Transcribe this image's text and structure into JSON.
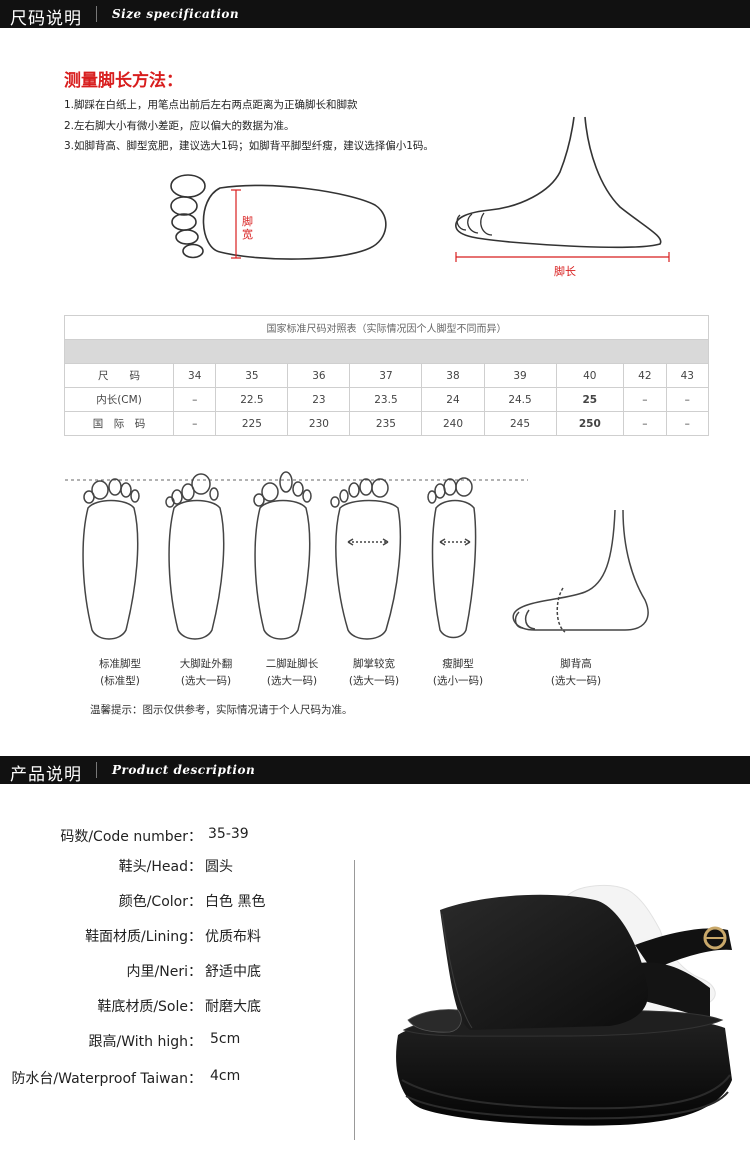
{
  "section1": {
    "title_cn": "尺码说明",
    "title_en": "Size specification"
  },
  "measure": {
    "title": "测量脚长方法：",
    "steps": [
      "1.脚踩在白纸上，用笔点出前后左右两点距离为正确脚长和脚款",
      "2.左右脚大小有微小差距，应以偏大的数据为准。",
      "3.如脚背高、脚型宽肥，建议选大1码；如脚背平脚型纤瘦，建议选择偏小1码。"
    ],
    "width_label": "脚宽",
    "length_label": "脚长"
  },
  "size_table": {
    "caption": "国家标准尺码对照表（实际情况因个人脚型不同而异）",
    "rows": [
      {
        "label": "尺　　码",
        "cells": [
          "34",
          "35",
          "36",
          "37",
          "38",
          "39",
          "40",
          "42",
          "43"
        ]
      },
      {
        "label": "内长(CM)",
        "cells": [
          "–",
          "22.5",
          "23",
          "23.5",
          "24",
          "24.5",
          "25",
          "–",
          "–"
        ]
      },
      {
        "label": "国　际　码",
        "cells": [
          "–",
          "225",
          "230",
          "235",
          "240",
          "245",
          "250",
          "–",
          "–"
        ]
      }
    ]
  },
  "foot_types": [
    {
      "name": "标准脚型",
      "advice": "(标准型)"
    },
    {
      "name": "大脚趾外翻",
      "advice": "(选大一码)"
    },
    {
      "name": "二脚趾脚长",
      "advice": "(选大一码)"
    },
    {
      "name": "脚掌较宽",
      "advice": "(选大一码)"
    },
    {
      "name": "瘦脚型",
      "advice": "(选小一码)"
    },
    {
      "name": "脚背高",
      "advice": "(选大一码)"
    }
  ],
  "tip": "温馨提示：图示仅供参考，实际情况请于个人尺码为准。",
  "section2": {
    "title_cn": "产品说明",
    "title_en": "Product description"
  },
  "specs": [
    {
      "label": "码数/Code number：",
      "value": "35-39"
    },
    {
      "label": "鞋头/Head：",
      "value": "圆头"
    },
    {
      "label": "颜色/Color：",
      "value": "白色 黑色"
    },
    {
      "label": "鞋面材质/Lining：",
      "value": "优质布料"
    },
    {
      "label": "内里/Neri：",
      "value": "舒适中底"
    },
    {
      "label": "鞋底材质/Sole：",
      "value": "耐磨大底"
    },
    {
      "label": "跟高/With high：",
      "value": "5cm"
    },
    {
      "label": "防水台/Waterproof Taiwan：",
      "value": "4cm"
    }
  ],
  "colors": {
    "bar": "#111111",
    "accent_red": "#d81e1e",
    "shoe": "#1a1a1a",
    "buckle": "#c9a86a"
  }
}
